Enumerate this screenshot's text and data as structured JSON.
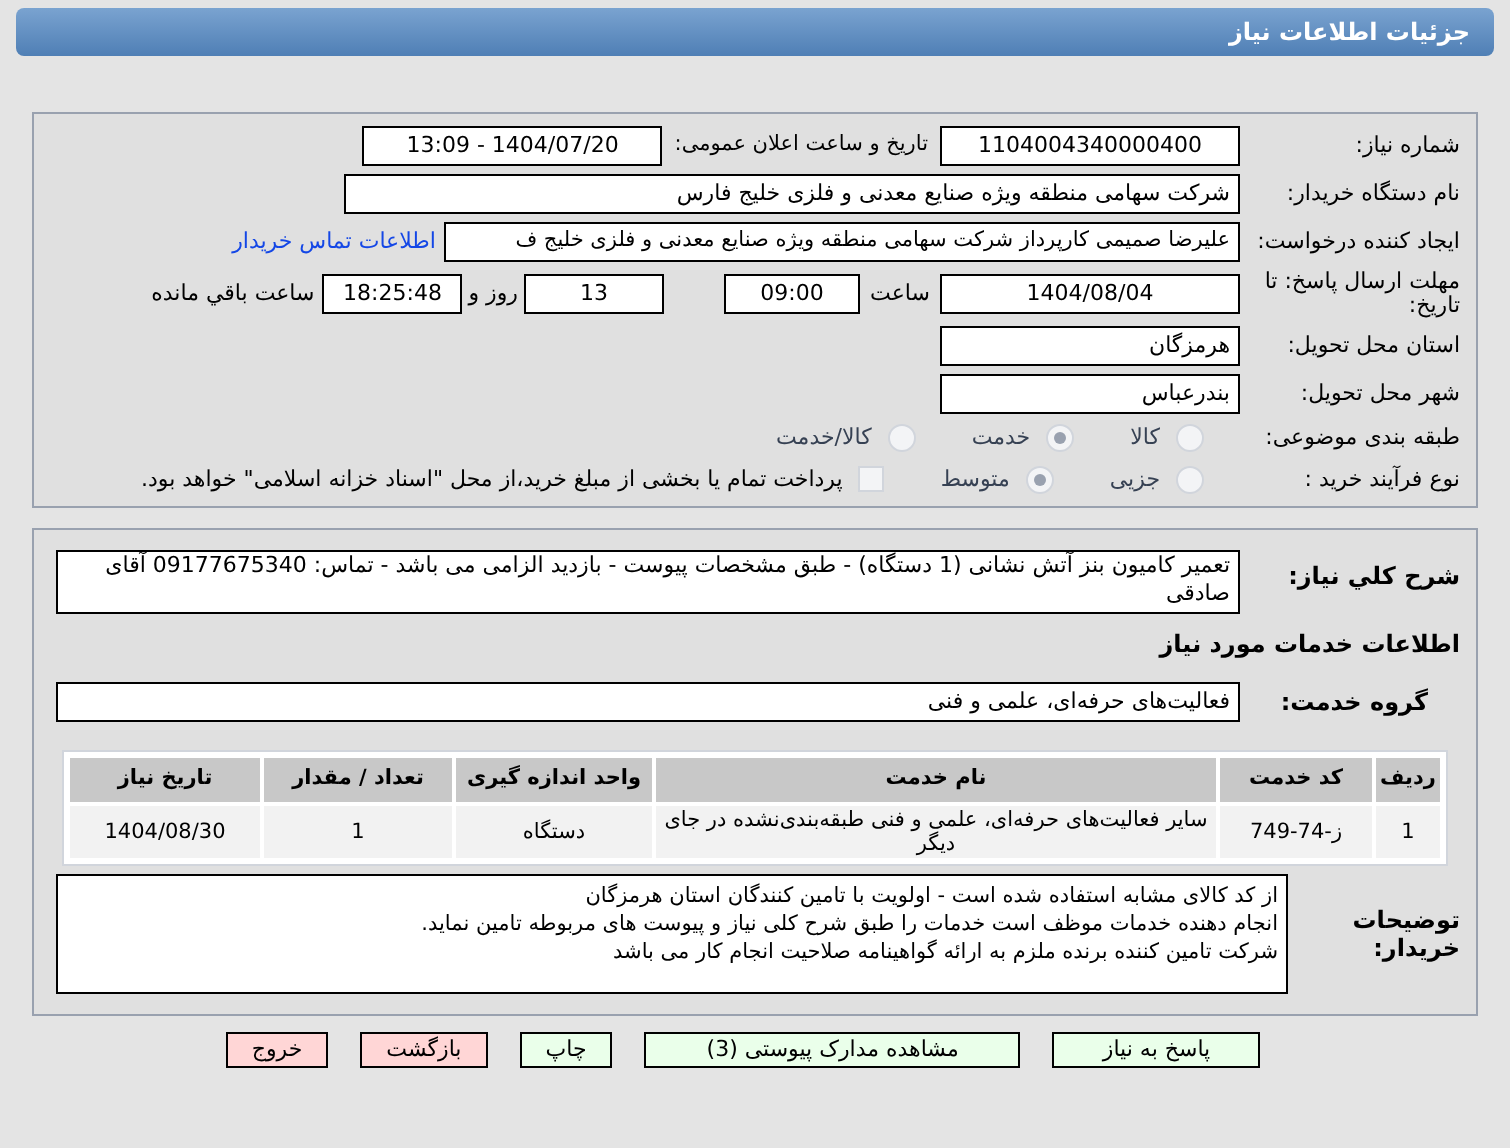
{
  "header": {
    "title": "جزئیات اطلاعات نیاز"
  },
  "need_number": {
    "label": "شماره نیاز:",
    "value": "1104004340000400"
  },
  "announce": {
    "label": "تاریخ و ساعت اعلان عمومی:",
    "value": "1404/07/20 - 13:09"
  },
  "buyer": {
    "label": "نام دستگاه خریدار:",
    "value": "شرکت سهامی منطقه ویژه صنایع معدنی و فلزی خلیج فارس"
  },
  "creator": {
    "label": "ایجاد کننده درخواست:",
    "value": "علیرضا صمیمی کارپرداز شرکت سهامی منطقه ویژه صنایع معدنی و فلزی خلیج ف",
    "link": "اطلاعات تماس خریدار"
  },
  "deadline": {
    "label": "مهلت ارسال پاسخ: تا تاریخ:",
    "date": "1404/08/04",
    "time_label": "ساعت",
    "time": "09:00",
    "days": "13",
    "days_label": "روز و",
    "remaining": "18:25:48",
    "remaining_label": "ساعت باقي مانده"
  },
  "province": {
    "label": "استان محل تحویل:",
    "value": "هرمزگان"
  },
  "city": {
    "label": "شهر محل تحویل:",
    "value": "بندرعباس"
  },
  "category": {
    "label": "طبقه بندی موضوعی:",
    "options": [
      {
        "label": "کالا",
        "selected": false
      },
      {
        "label": "خدمت",
        "selected": true
      },
      {
        "label": "کالا/خدمت",
        "selected": false
      }
    ]
  },
  "process": {
    "label": "نوع فرآیند خرید :",
    "options": [
      {
        "label": "جزیی",
        "selected": false
      },
      {
        "label": "متوسط",
        "selected": true
      }
    ],
    "payment": {
      "checked": false,
      "text": "پرداخت تمام یا بخشی از مبلغ خرید،از محل \"اسناد خزانه اسلامی\" خواهد بود."
    }
  },
  "summary": {
    "label": "شرح کلي نياز:",
    "value": "تعمیر کامیون بنز آتش نشانی (1 دستگاه) - طبق مشخصات پیوست - بازدید الزامی می باشد - تماس: 09177675340 آقای صادقی"
  },
  "services_title": "اطلاعات خدمات مورد نیاز",
  "service_group": {
    "label": "گروه خدمت:",
    "value": "فعالیت‌های حرفه‌ای، علمی و فنی"
  },
  "table": {
    "columns": [
      "ردیف",
      "کد خدمت",
      "نام خدمت",
      "واحد اندازه گیری",
      "تعداد / مقدار",
      "تاریخ نیاز"
    ],
    "rows": [
      [
        "1",
        "ز-74-749",
        "سایر فعالیت‌های حرفه‌ای، علمی و فنی طبقه‌بندی‌نشده در جای دیگر",
        "دستگاه",
        "1",
        "1404/08/30"
      ]
    ]
  },
  "buyer_notes": {
    "label": "توضیحات خریدار:",
    "lines": [
      "از کد کالای مشابه استفاده شده است - اولویت با تامین کنندگان استان هرمزگان",
      "انجام دهنده خدمات موظف است خدمات را طبق شرح کلی نیاز و پیوست های مربوطه تامین نماید.",
      "شرکت تامین کننده برنده ملزم به ارائه گواهینامه صلاحیت انجام کار می باشد"
    ]
  },
  "buttons": [
    {
      "label": "پاسخ به نیاز",
      "kind": "primary"
    },
    {
      "label": "مشاهده مدارک پیوستی (3)",
      "kind": "primary"
    },
    {
      "label": "چاپ",
      "kind": "primary"
    },
    {
      "label": "بازگشت",
      "kind": "danger"
    },
    {
      "label": "خروج",
      "kind": "danger"
    }
  ]
}
